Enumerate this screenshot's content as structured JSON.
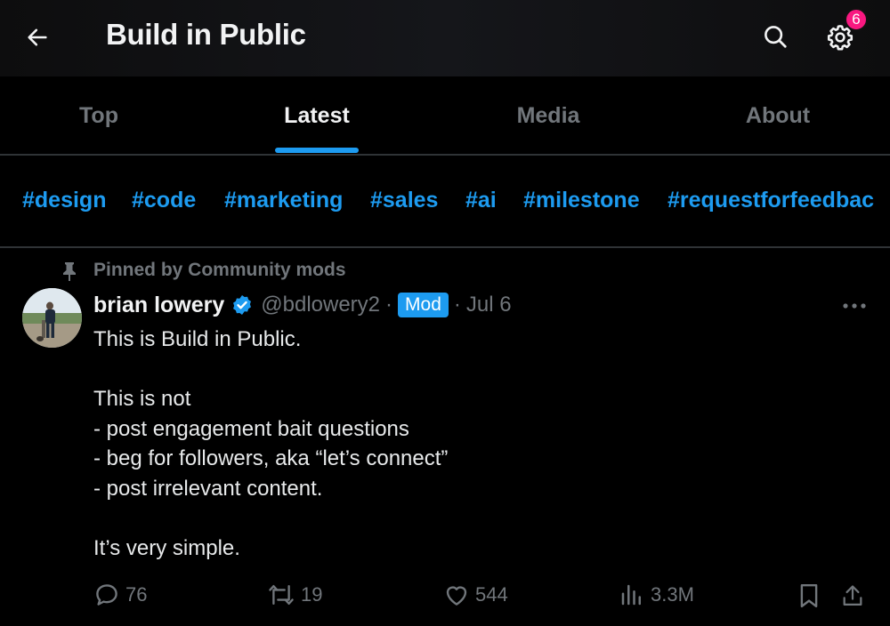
{
  "header": {
    "title": "Build in Public",
    "notification_count": "6"
  },
  "tabs": [
    {
      "label": "Top",
      "active": false
    },
    {
      "label": "Latest",
      "active": true
    },
    {
      "label": "Media",
      "active": false
    },
    {
      "label": "About",
      "active": false
    }
  ],
  "hashtags": [
    "#design",
    "#code",
    "#marketing",
    "#sales",
    "#ai",
    "#milestone",
    "#requestforfeedbac"
  ],
  "post": {
    "pinned_label": "Pinned by Community mods",
    "author_name": "brian lowery",
    "handle": "@bdlowery2",
    "separator": "·",
    "role_badge": "Mod",
    "date": "Jul 6",
    "lines": [
      "This is Build in Public.",
      "",
      "This is not",
      "- post engagement bait questions",
      "- beg for followers, aka “let’s connect”",
      "- post irrelevant content.",
      "",
      "It’s very simple."
    ],
    "stats": {
      "replies": "76",
      "reposts": "19",
      "likes": "544",
      "views": "3.3M"
    }
  },
  "colors": {
    "accent": "#1d9bf0",
    "badge": "#f91880",
    "muted": "#71767b",
    "background": "#000000"
  }
}
